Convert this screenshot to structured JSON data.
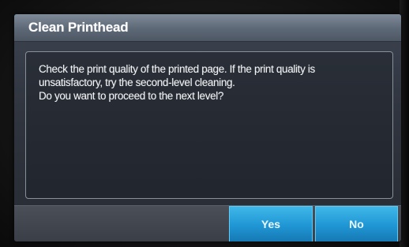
{
  "dialog": {
    "title": "Clean Printhead",
    "message_lines": [
      "Check the print quality of the printed page. If the print quality is",
      "unsatisfactory, try the second-level cleaning.",
      "Do you want to proceed to the next level?"
    ]
  },
  "buttons": {
    "yes_label": "Yes",
    "no_label": "No"
  },
  "colors": {
    "title_bar": "#5d6876",
    "button_accent": "#1f96d4",
    "screen_bg": "#2f343e"
  }
}
